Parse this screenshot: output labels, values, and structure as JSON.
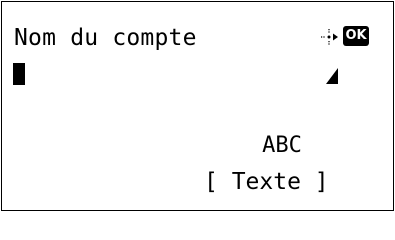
{
  "screen": {
    "title": "Nom du compte",
    "ok_label": "OK",
    "nav_icon": "four-way-arrows-icon",
    "input_value": "",
    "corner_icon": "triangle-corner-icon",
    "input_mode": "ABC",
    "softkey_label": "[ Texte ]"
  }
}
